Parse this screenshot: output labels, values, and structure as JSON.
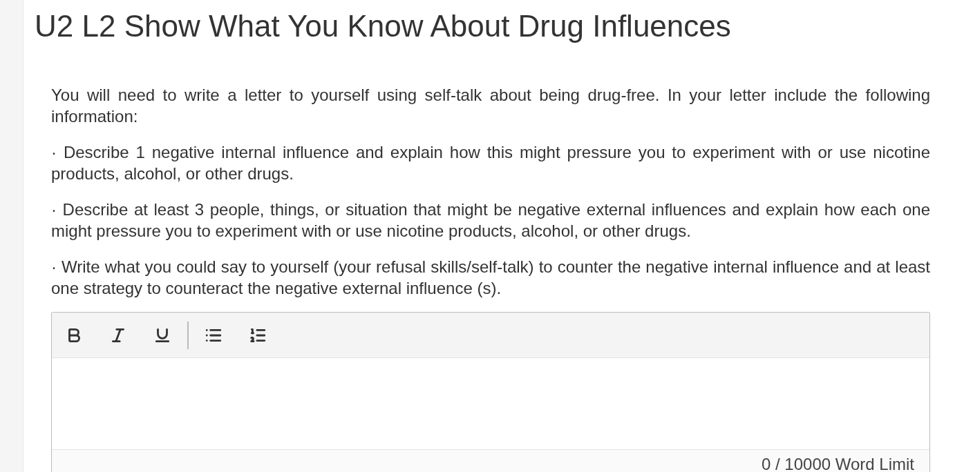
{
  "title": "U2 L2 Show What You Know About Drug Influences",
  "paragraphs": [
    "You will need to write a letter to yourself using self-talk about being drug-free. In your letter include the following information:",
    "· Describe 1 negative internal influence and explain how this might pressure you to experiment with or use nicotine products, alcohol, or other drugs.",
    "· Describe at least 3 people, things, or situation that might be negative external influences and explain how each one might pressure you to experiment with or use nicotine products, alcohol, or other drugs.",
    "· Write what you could say to yourself (your refusal skills/self-talk) to counter the negative internal influence and at least one strategy to counteract the negative external influence (s)."
  ],
  "editor": {
    "tools": [
      {
        "kind": "bold"
      },
      {
        "kind": "italic"
      },
      {
        "kind": "underline"
      },
      {
        "kind": "divider"
      },
      {
        "kind": "bullets"
      },
      {
        "kind": "numbers"
      }
    ],
    "word_limit": "0 / 10000 Word Limit"
  }
}
